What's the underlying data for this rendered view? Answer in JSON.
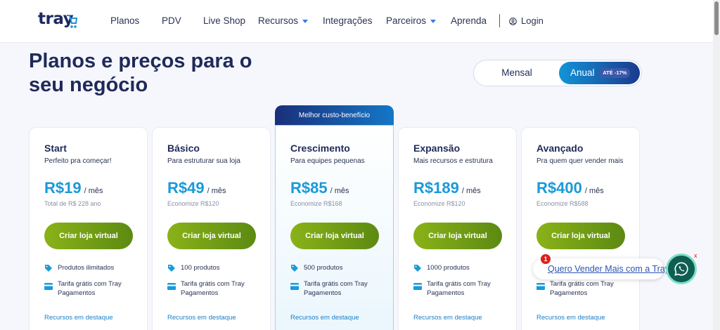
{
  "header": {
    "logo_text": "tray",
    "nav": [
      {
        "label": "Planos"
      },
      {
        "label": "PDV"
      },
      {
        "label": "Live Shop"
      },
      {
        "label": "Recursos"
      },
      {
        "label": "Integrações"
      },
      {
        "label": "Parceiros"
      },
      {
        "label": "Aprenda"
      }
    ],
    "login_label": "Login"
  },
  "hero": {
    "title": "Planos e preços para o seu negócio"
  },
  "billing_toggle": {
    "monthly_label": "Mensal",
    "annual_label": "Anual",
    "annual_badge": "ATÉ -17%",
    "selected": "Anual"
  },
  "featured_banner": "Melhor custo-benefício",
  "plans": [
    {
      "name": "Start",
      "description": "Perfeito pra começar!",
      "price": "R$19",
      "period": "/ mês",
      "note": "Total de R$ 228 ano",
      "cta": "Criar loja virtual",
      "features": [
        "Produtos ilimitados",
        "Tarifa grátis com Tray Pagamentos"
      ],
      "resources_link": "Recursos em destaque"
    },
    {
      "name": "Básico",
      "description": "Para estruturar sua loja",
      "price": "R$49",
      "period": "/ mês",
      "note": "Economize R$120",
      "cta": "Criar loja virtual",
      "features": [
        "100 produtos",
        "Tarifa grátis com Tray Pagamentos"
      ],
      "resources_link": "Recursos em destaque"
    },
    {
      "name": "Crescimento",
      "description": "Para equipes pequenas",
      "price": "R$85",
      "period": "/ mês",
      "note": "Economize R$168",
      "cta": "Criar loja virtual",
      "features": [
        "500 produtos",
        "Tarifa grátis com Tray Pagamentos"
      ],
      "resources_link": "Recursos em destaque"
    },
    {
      "name": "Expansão",
      "description": "Mais recursos e estrutura",
      "price": "R$189",
      "period": "/ mês",
      "note": "Economize R$120",
      "cta": "Criar loja virtual",
      "features": [
        "1000 produtos",
        "Tarifa grátis com Tray Pagamentos"
      ],
      "resources_link": "Recursos em destaque"
    },
    {
      "name": "Avançado",
      "description": "Pra quem quer vender mais",
      "price": "R$400",
      "period": "/ mês",
      "note": "Economize R$588",
      "cta": "Criar loja virtual",
      "features": [
        "",
        "Tarifa grátis com Tray Pagamentos"
      ],
      "resources_link": "Recursos em destaque"
    }
  ],
  "chat_widget": {
    "message": "Quero Vender Mais com a Tray",
    "badge_count": "1",
    "close_label": "x",
    "icon": "whatsapp-icon"
  },
  "colors": {
    "brand_navy": "#1f2a5a",
    "price_blue": "#1a9ad9",
    "cta_green": "#7aa316",
    "whatsapp_green": "#0f5e52"
  }
}
